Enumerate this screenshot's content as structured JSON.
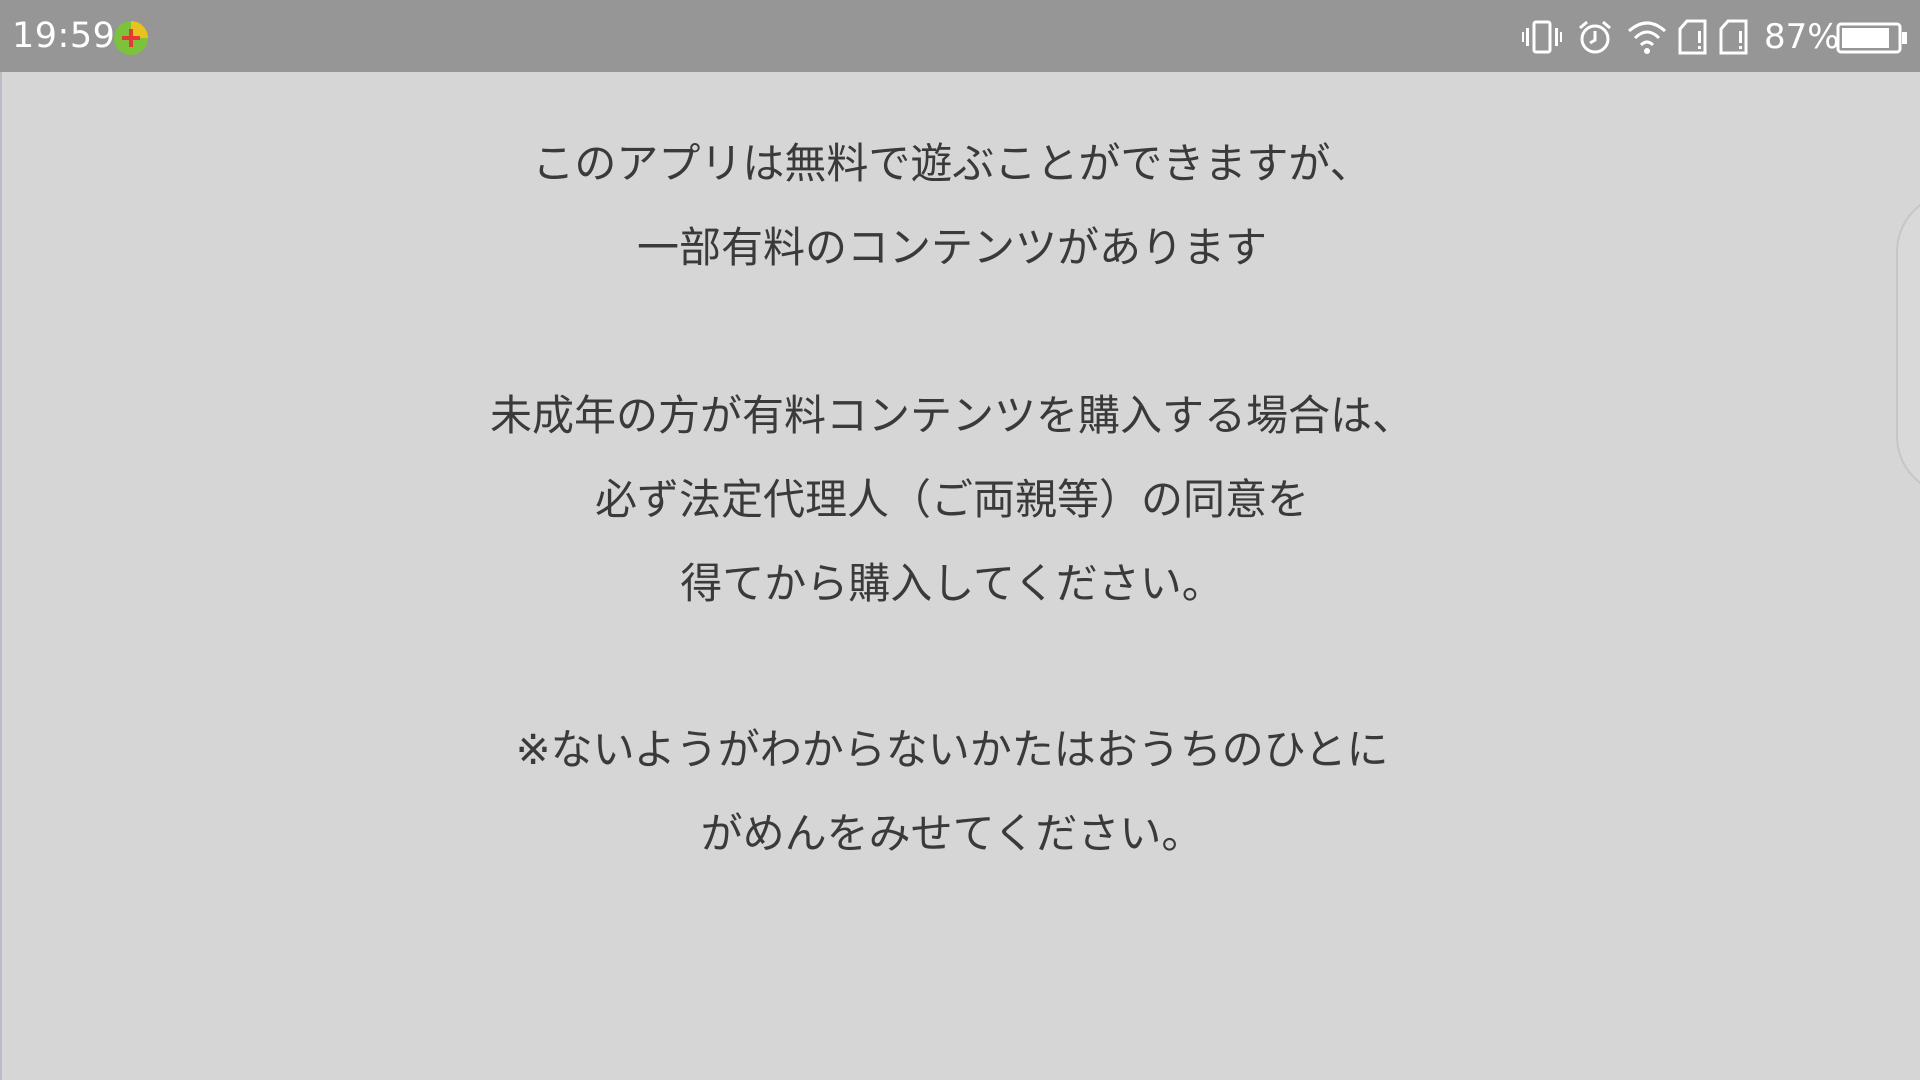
{
  "status_bar": {
    "time": "19:59",
    "notification_icon": "green-plus-circle-icon",
    "icons": [
      "vibrate-icon",
      "alarm-icon",
      "wifi-icon",
      "sim-card-icon",
      "sim-card-icon",
      "battery-icon"
    ],
    "battery_percent": "87%",
    "background_color": "#969696"
  },
  "notice": {
    "paragraph1": {
      "line1": "このアプリは無料で遊ぶことができますが、",
      "line2": "一部有料のコンテンツがあります"
    },
    "paragraph2": {
      "line1": "未成年の方が有料コンテンツを購入する場合は、",
      "line2": "必ず法定代理人（ご両親等）の同意を",
      "line3": "得てから購入してください。"
    },
    "paragraph3": {
      "line1": "※ないようがわからないかたはおうちのひとに",
      "line2": "がめんをみせてください。"
    },
    "background_color": "#d6d6d6",
    "text_color": "#3a3a3a"
  }
}
